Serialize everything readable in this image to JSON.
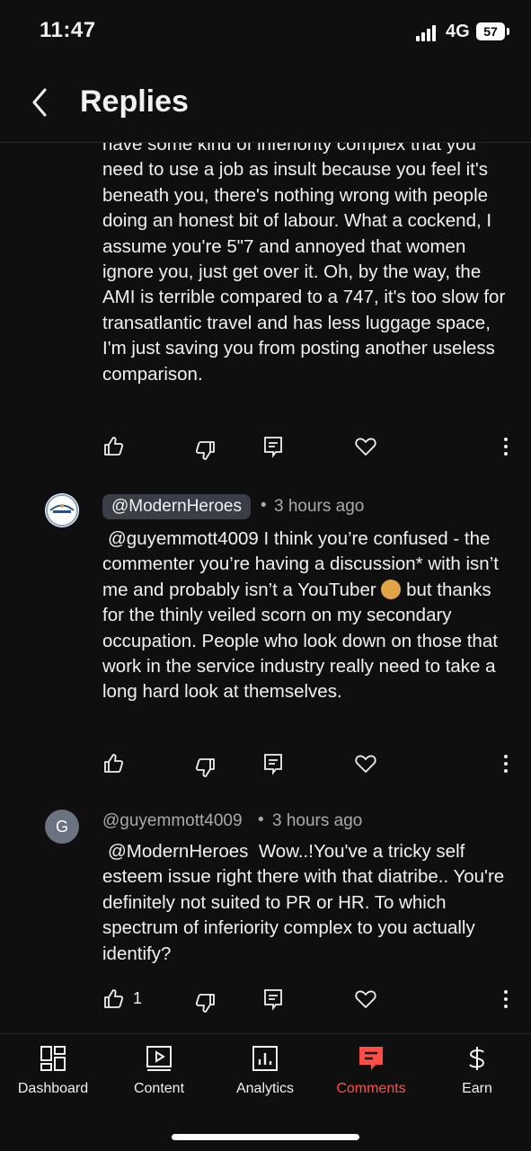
{
  "status_bar": {
    "time": "11:47",
    "network": "4G",
    "battery": "57"
  },
  "header": {
    "title": "Replies"
  },
  "comments": [
    {
      "text": "have some kind of inferiority complex that you need to use a job as insult because you feel it's beneath you, there's nothing wrong with people doing an honest bit of labour. What a cockend, I assume you're 5\"7 and annoyed that women ignore you, just get over it. Oh, by the way, the AMI is terrible compared to a 747, it's too slow for transatlantic travel and has less luggage space, I'm just saving you from posting another useless comparison."
    },
    {
      "author": "@ModernHeroes",
      "time": "3 hours ago",
      "mention": "@guyemmott4009",
      "text_before_emoji": "I think you’re confused - the commenter you’re having a discussion* with isn’t me and probably isn’t a YouTuber",
      "text_after_emoji": "but thanks for the thinly veiled scorn on my secondary occupation. People who look down on those that work in the service industry really need to take a long hard look at themselves."
    },
    {
      "author": "@guyemmott4009",
      "avatar_letter": "G",
      "time": "3 hours ago",
      "mention": "@ModernHeroes",
      "text": "Wow..!You've a tricky self esteem issue right there with that diatribe.. You're definitely not suited to PR or HR. To which spectrum of inferiority complex to you actually identify?",
      "likes": "1"
    }
  ],
  "separator": "•",
  "bottom_nav": [
    {
      "label": "Dashboard",
      "icon": "dashboard-icon"
    },
    {
      "label": "Content",
      "icon": "content-icon"
    },
    {
      "label": "Analytics",
      "icon": "analytics-icon"
    },
    {
      "label": "Comments",
      "icon": "comments-icon",
      "active": true
    },
    {
      "label": "Earn",
      "icon": "earn-icon"
    }
  ],
  "colors": {
    "background": "#0f0f0f",
    "accent": "#ff4e45",
    "chip": "#3a3f47",
    "muted": "#aaaaaa"
  }
}
